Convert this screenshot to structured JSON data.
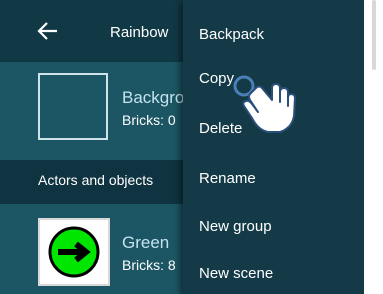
{
  "toolbar": {
    "title": "Rainbow"
  },
  "background": {
    "name": "Backgro",
    "bricks": "Bricks: 0"
  },
  "section": {
    "title": "Actors and objects"
  },
  "object": {
    "name": "Green",
    "bricks": "Bricks: 8"
  },
  "context_menu": {
    "items": [
      {
        "label": "Backpack"
      },
      {
        "label": "Copy"
      },
      {
        "label": "Delete"
      },
      {
        "label": "Rename"
      },
      {
        "label": "New group"
      },
      {
        "label": "New scene"
      }
    ]
  },
  "colors": {
    "toolbar_bg": "#113845",
    "list_bg": "#1c5563",
    "menu_bg": "#143a48",
    "object_green": "#00e600"
  }
}
